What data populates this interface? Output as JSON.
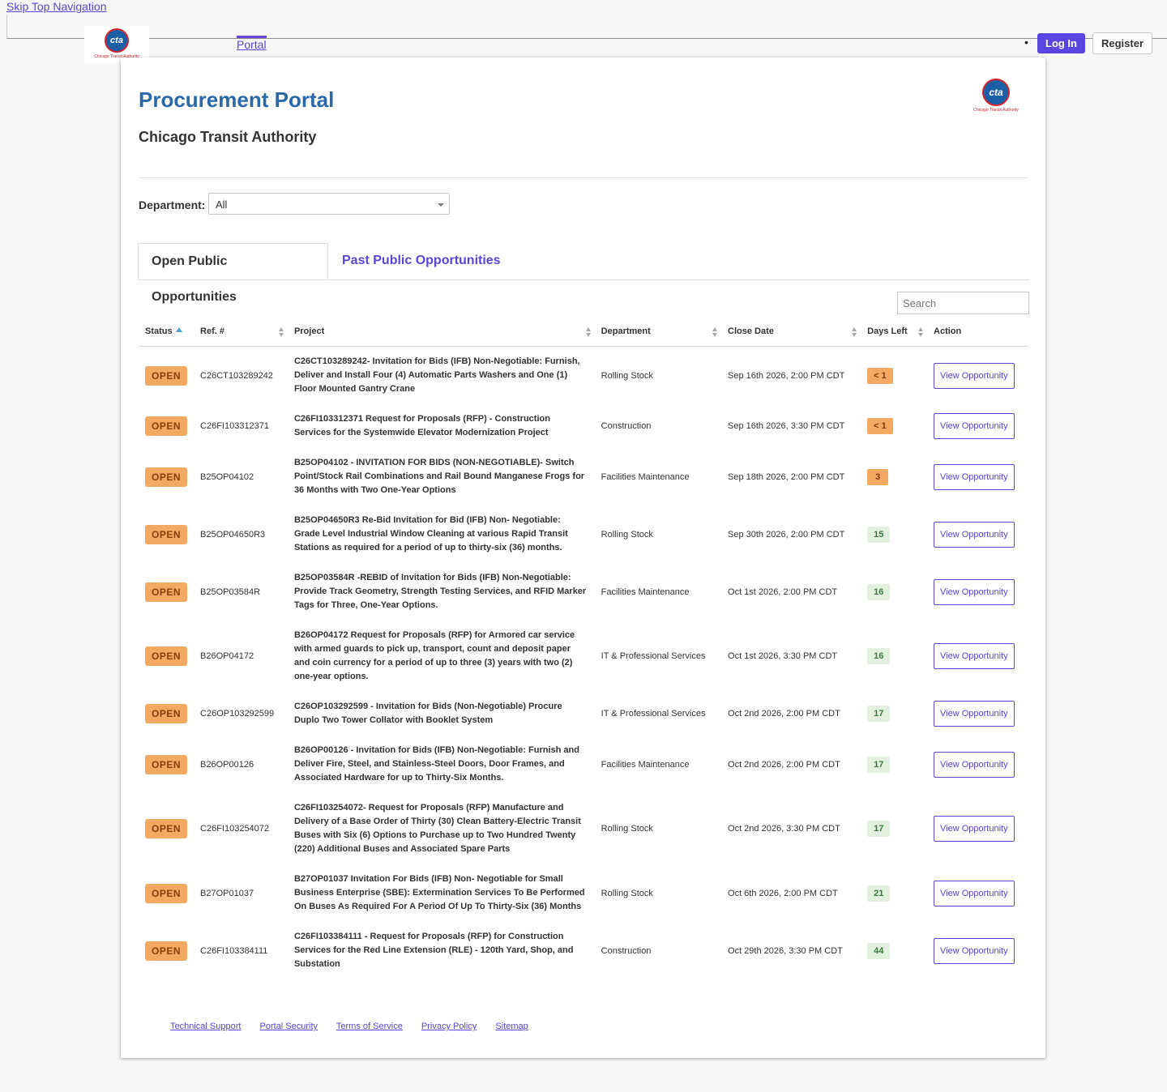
{
  "skip_link": "Skip Top Navigation",
  "nav": {
    "logo_text": "cta",
    "logo_caption": "Chicago Transit Authority",
    "portal_label": "Portal",
    "bullet": "•",
    "login_label": "Log In",
    "register_label": "Register"
  },
  "header": {
    "title": "Procurement Portal",
    "subtitle": "Chicago Transit Authority"
  },
  "filter": {
    "label": "Department:",
    "selected": "All"
  },
  "tabs": [
    {
      "label": "Open Public Opportunities",
      "active": true
    },
    {
      "label": "Past Public Opportunities",
      "active": false
    }
  ],
  "search": {
    "placeholder": "Search"
  },
  "table": {
    "columns": [
      "Status",
      "Ref. #",
      "Project",
      "Department",
      "Close Date",
      "Days Left",
      "Action"
    ],
    "rows": [
      {
        "status": "OPEN",
        "ref": "C26CT103289242",
        "project": "C26CT103289242- Invitation for Bids (IFB) Non-Negotiable: Furnish, Deliver and Install Four (4) Automatic Parts Washers and One (1) Floor Mounted Gantry Crane",
        "department": "Rolling Stock",
        "close_date": "Sep 16th 2026, 2:00 PM CDT",
        "days_left": "< 1",
        "urgent": true,
        "action": "View Opportunity"
      },
      {
        "status": "OPEN",
        "ref": "C26FI103312371",
        "project": "C26FI103312371 Request for Proposals (RFP) - Construction Services for the Systemwide Elevator Modernization Project",
        "department": "Construction",
        "close_date": "Sep 16th 2026, 3:30 PM CDT",
        "days_left": "< 1",
        "urgent": true,
        "action": "View Opportunity"
      },
      {
        "status": "OPEN",
        "ref": "B25OP04102",
        "project": "B25OP04102 - INVITATION FOR BIDS (NON-NEGOTIABLE)- Switch Point/Stock Rail Combinations and Rail Bound Manganese Frogs for 36 Months with Two One-Year Options",
        "department": "Facilities Maintenance",
        "close_date": "Sep 18th 2026, 2:00 PM CDT",
        "days_left": "3",
        "urgent": true,
        "action": "View Opportunity"
      },
      {
        "status": "OPEN",
        "ref": "B25OP04650R3",
        "project": "B25OP04650R3 Re-Bid Invitation for Bid (IFB) Non- Negotiable: Grade Level Industrial Window Cleaning at various Rapid Transit Stations as required for a period of up to thirty-six (36) months.",
        "department": "Rolling Stock",
        "close_date": "Sep 30th 2026, 2:00 PM CDT",
        "days_left": "15",
        "urgent": false,
        "action": "View Opportunity"
      },
      {
        "status": "OPEN",
        "ref": "B25OP03584R",
        "project": "B25OP03584R -REBID of Invitation for Bids (IFB) Non-Negotiable: Provide Track Geometry, Strength Testing Services, and RFID Marker Tags for Three, One-Year Options.",
        "department": "Facilities Maintenance",
        "close_date": "Oct 1st 2026, 2:00 PM CDT",
        "days_left": "16",
        "urgent": false,
        "action": "View Opportunity"
      },
      {
        "status": "OPEN",
        "ref": "B26OP04172",
        "project": "B26OP04172 Request for Proposals (RFP) for Armored car service with armed guards to pick up, transport, count and deposit paper and coin currency for a period of up to three (3) years with two (2) one-year options.",
        "department": "IT & Professional Services",
        "close_date": "Oct 1st 2026, 3:30 PM CDT",
        "days_left": "16",
        "urgent": false,
        "action": "View Opportunity"
      },
      {
        "status": "OPEN",
        "ref": "C26OP103292599",
        "project": "C26OP103292599 - Invitation for Bids (Non-Negotiable) Procure Duplo Two Tower Collator with Booklet System",
        "department": "IT & Professional Services",
        "close_date": "Oct 2nd 2026, 2:00 PM CDT",
        "days_left": "17",
        "urgent": false,
        "action": "View Opportunity"
      },
      {
        "status": "OPEN",
        "ref": "B26OP00126",
        "project": "B26OP00126 - Invitation for Bids (IFB) Non-Negotiable: Furnish and Deliver Fire, Steel, and Stainless-Steel Doors, Door Frames, and Associated Hardware for up to Thirty-Six Months.",
        "department": "Facilities Maintenance",
        "close_date": "Oct 2nd 2026, 2:00 PM CDT",
        "days_left": "17",
        "urgent": false,
        "action": "View Opportunity"
      },
      {
        "status": "OPEN",
        "ref": "C26FI103254072",
        "project": "C26FI103254072- Request for Proposals (RFP) Manufacture and Delivery of a Base Order of Thirty (30) Clean Battery-Electric Transit Buses with Six (6) Options to Purchase up to Two Hundred Twenty (220) Additional Buses and Associated Spare Parts",
        "department": "Rolling Stock",
        "close_date": "Oct 2nd 2026, 3:30 PM CDT",
        "days_left": "17",
        "urgent": false,
        "action": "View Opportunity"
      },
      {
        "status": "OPEN",
        "ref": "B27OP01037",
        "project": "B27OP01037 Invitation For Bids (IFB) Non- Negotiable for Small Business Enterprise (SBE): Extermination Services To Be Performed On Buses As Required For A Period Of Up To Thirty-Six (36) Months",
        "department": "Rolling Stock",
        "close_date": "Oct 6th 2026, 2:00 PM CDT",
        "days_left": "21",
        "urgent": false,
        "action": "View Opportunity"
      },
      {
        "status": "OPEN",
        "ref": "C26FI103384111",
        "project": "C26FI103384111 - Request for Proposals (RFP) for Construction Services for the Red Line Extension (RLE) - 120th Yard, Shop, and Substation",
        "department": "Construction",
        "close_date": "Oct 29th 2026, 3:30 PM CDT",
        "days_left": "44",
        "urgent": false,
        "action": "View Opportunity"
      }
    ]
  },
  "footer": {
    "links": [
      "Technical Support",
      "Portal Security",
      "Terms of Service",
      "Privacy Policy",
      "Sitemap"
    ]
  },
  "colors": {
    "accent": "#5b45d8",
    "title_blue": "#2a68a8",
    "open_badge": "#f4a962",
    "days_ok": "#e3f0e0"
  }
}
